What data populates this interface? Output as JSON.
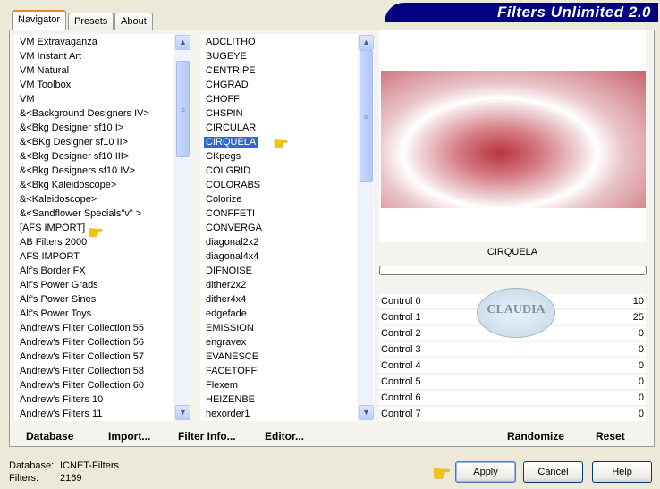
{
  "app": {
    "title": "Filters Unlimited 2.0"
  },
  "tabs": [
    {
      "label": "Navigator",
      "active": true
    },
    {
      "label": "Presets"
    },
    {
      "label": "About"
    }
  ],
  "categories": [
    "VM Extravaganza",
    "VM Instant Art",
    "VM Natural",
    "VM Toolbox",
    "VM",
    "&<Background Designers IV>",
    "&<Bkg Designer sf10 I>",
    "&<BKg Designer sf10 II>",
    "&<Bkg Designer sf10 III>",
    "&<Bkg Designers sf10 IV>",
    "&<Bkg Kaleidoscope>",
    "&<Kaleidoscope>",
    "&<Sandflower Specials\"v\" >",
    "[AFS IMPORT]",
    "AB Filters 2000",
    "AFS IMPORT",
    "Alf's Border FX",
    "Alf's Power Grads",
    "Alf's Power Sines",
    "Alf's Power Toys",
    "Andrew's Filter Collection 55",
    "Andrew's Filter Collection 56",
    "Andrew's Filter Collection 57",
    "Andrew's Filter Collection 58",
    "Andrew's Filter Collection 60",
    "Andrew's Filters 10",
    "Andrew's Filters 11"
  ],
  "filters": [
    "ADCLITHO",
    "BUGEYE",
    "CENTRIPE",
    "CHGRAD",
    "CHOFF",
    "CHSPIN",
    "CIRCULAR",
    "CIRQUELA",
    "CKpegs",
    "COLGRID",
    "COLORABS",
    "Colorize",
    "CONFFETI",
    "CONVERGA",
    "diagonal2x2",
    "diagonal4x4",
    "DIFNOISE",
    "dither2x2",
    "dither4x4",
    "edgefade",
    "EMISSION",
    "engravex",
    "EVANESCE",
    "FACETOFF",
    "Flexem",
    "HEIZENBE",
    "hexorder1"
  ],
  "selected_category": "[AFS IMPORT]",
  "selected_filter": "CIRQUELA",
  "preview": {
    "filter_name": "CIRQUELA",
    "progress": 0,
    "watermark": "CLAUDIA"
  },
  "controls": [
    {
      "label": "Control 0",
      "value": "10"
    },
    {
      "label": "Control 1",
      "value": "25"
    },
    {
      "label": "Control 2",
      "value": "0"
    },
    {
      "label": "Control 3",
      "value": "0"
    },
    {
      "label": "Control 4",
      "value": "0"
    },
    {
      "label": "Control 5",
      "value": "0"
    },
    {
      "label": "Control 6",
      "value": "0"
    },
    {
      "label": "Control 7",
      "value": "0"
    }
  ],
  "panel_buttons": {
    "database": "Database",
    "import": "Import...",
    "filter_info": "Filter Info...",
    "editor": "Editor...",
    "randomize": "Randomize",
    "reset": "Reset"
  },
  "status": {
    "database_label": "Database:",
    "database_value": "ICNET-Filters",
    "filters_label": "Filters:",
    "filters_value": "2169"
  },
  "dialog_buttons": {
    "apply": "Apply",
    "cancel": "Cancel",
    "help": "Help"
  },
  "colors": {
    "banner": "#000080",
    "selection": "#316AC5",
    "preview_red": "#B8343F"
  }
}
